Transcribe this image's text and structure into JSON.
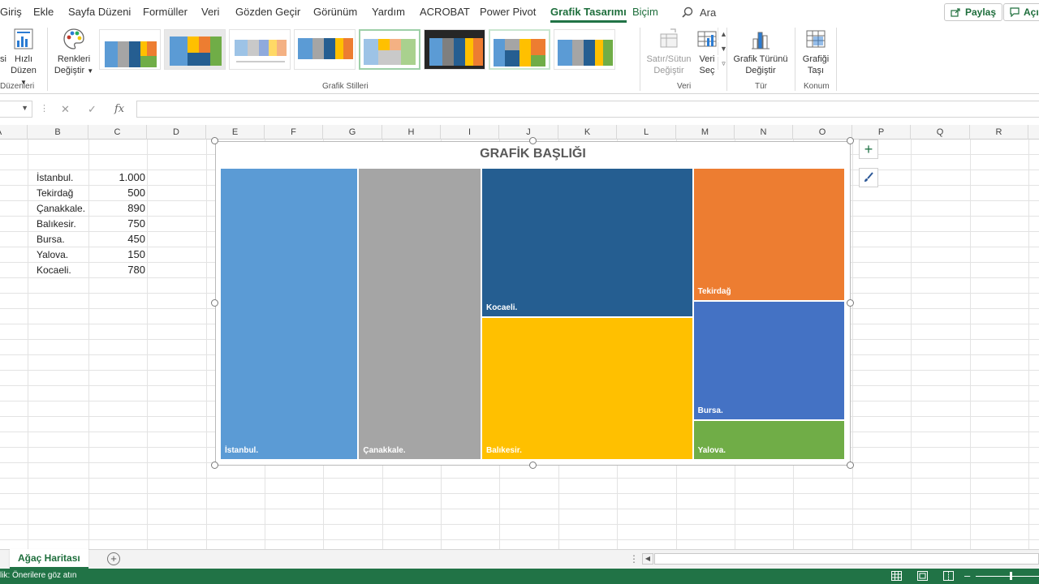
{
  "ribbon_tabs": [
    "Giriş",
    "Ekle",
    "Sayfa Düzeni",
    "Formüller",
    "Veri",
    "Gözden Geçir",
    "Görünüm",
    "Yardım",
    "ACROBAT",
    "Power Pivot",
    "Grafik Tasarımı",
    "Biçim"
  ],
  "active_tab": "Grafik Tasarımı",
  "search": {
    "label": "Ara"
  },
  "share_button": "Paylaş",
  "comments_button": "Açık",
  "ribbon": {
    "group_duzen_label": "Düzenleri",
    "quick_layout": [
      "Hızlı",
      "Düzen"
    ],
    "change_colors": [
      "Renkleri",
      "Değiştir"
    ],
    "styles_group_label": "Grafik Stilleri",
    "switch_row_col": [
      "Satır/Sütun",
      "Değiştir"
    ],
    "select_data": [
      "Veri",
      "Seç"
    ],
    "data_group_label": "Veri",
    "change_chart_type": [
      "Grafik Türünü",
      "Değiştir"
    ],
    "type_group_label": "Tür",
    "move_chart": [
      "Grafiği",
      "Taşı"
    ],
    "location_group_label": "Konum",
    "partial_left_label": "si"
  },
  "formula_bar": {
    "fx": "fx"
  },
  "columns": [
    "A",
    "B",
    "C",
    "D",
    "E",
    "F",
    "G",
    "H",
    "I",
    "J",
    "K",
    "L",
    "M",
    "N",
    "O",
    "P",
    "Q",
    "R"
  ],
  "table": [
    {
      "city": "İstanbul.",
      "value": "1.000"
    },
    {
      "city": "Tekirdağ",
      "value": "500"
    },
    {
      "city": "Çanakkale.",
      "value": "890"
    },
    {
      "city": "Balıkesir.",
      "value": "750"
    },
    {
      "city": "Bursa.",
      "value": "450"
    },
    {
      "city": "Yalova.",
      "value": "150"
    },
    {
      "city": "Kocaeli.",
      "value": "780"
    }
  ],
  "chart_data": {
    "type": "treemap",
    "title": "GRAFİK BAŞLIĞI",
    "categories": [
      "İstanbul.",
      "Tekirdağ",
      "Çanakkale.",
      "Balıkesir.",
      "Bursa.",
      "Yalova.",
      "Kocaeli."
    ],
    "values": [
      1000,
      500,
      890,
      750,
      450,
      150,
      780
    ],
    "colors": {
      "İstanbul.": "#5b9bd5",
      "Çanakkale.": "#a5a5a5",
      "Kocaeli.": "#255e91",
      "Balıkesir.": "#ffc000",
      "Tekirdağ": "#ed7d31",
      "Bursa.": "#4472c4",
      "Yalova.": "#70ad47"
    }
  },
  "sheet_tab": "Ağaç Haritası",
  "status_text": "lik: Önerilere göz atın",
  "accent_color": "#217346"
}
